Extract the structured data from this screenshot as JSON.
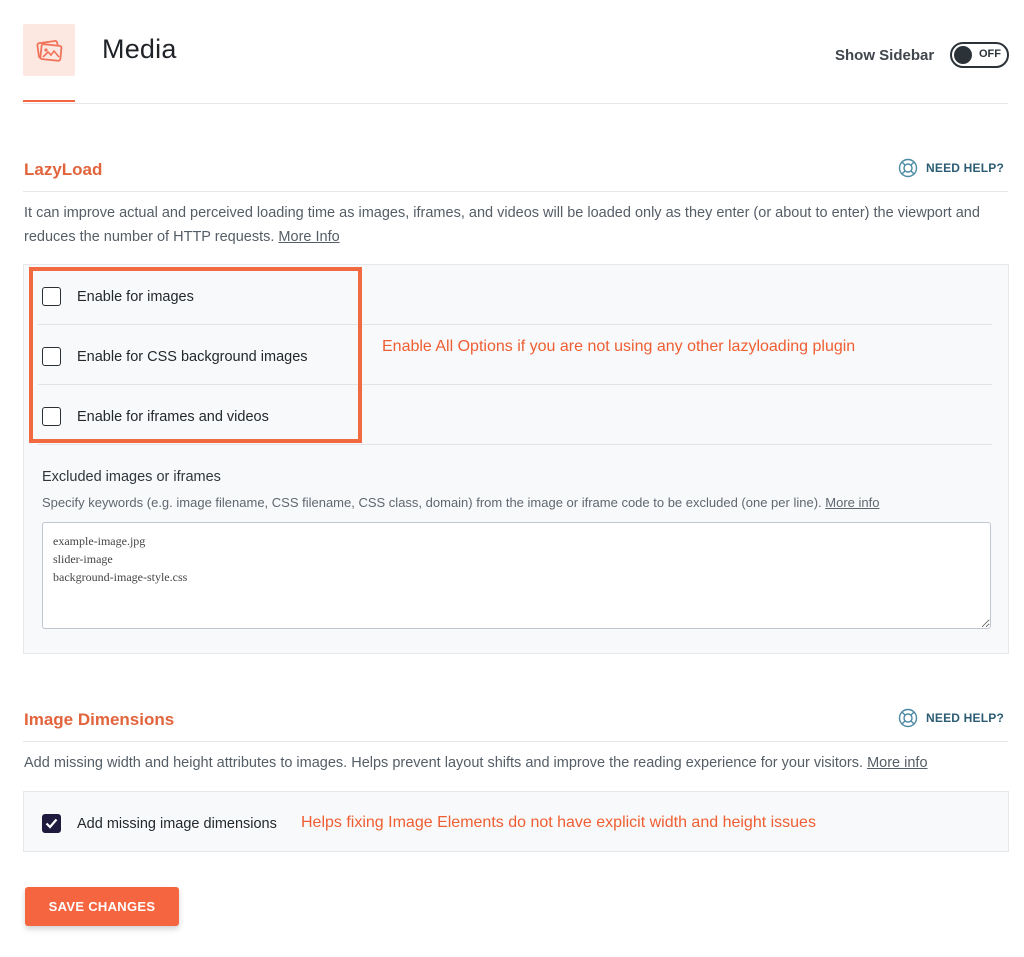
{
  "header": {
    "title": "Media",
    "icon": "image-icon",
    "sidebar_label": "Show Sidebar",
    "sidebar_toggle_state": "OFF"
  },
  "lazyload": {
    "title": "LazyLoad",
    "help_label": "NEED HELP?",
    "description": "It can improve actual and perceived loading time as images, iframes, and videos will be loaded only as they enter (or about to enter) the viewport and reduces the number of HTTP requests.",
    "more_info": "More Info",
    "options": [
      {
        "label": "Enable for images",
        "checked": false
      },
      {
        "label": "Enable for CSS background images",
        "checked": false
      },
      {
        "label": "Enable for iframes and videos",
        "checked": false
      }
    ],
    "annotation": "Enable All Options if you are not using any other lazyloading plugin",
    "excluded": {
      "label": "Excluded images or iframes",
      "help": "Specify keywords (e.g. image filename, CSS filename, CSS class, domain) from the image or iframe code to be excluded (one per line).",
      "more_info": "More info",
      "value": "example-image.jpg\nslider-image\nbackground-image-style.css"
    }
  },
  "dimensions": {
    "title": "Image Dimensions",
    "help_label": "NEED HELP?",
    "description": "Add missing width and height attributes to images. Helps prevent layout shifts and improve the reading experience for your visitors.",
    "more_info": "More info",
    "option": {
      "label": "Add missing image dimensions",
      "checked": true
    },
    "annotation": "Helps fixing Image Elements do not have explicit width and height issues"
  },
  "actions": {
    "save_label": "SAVE CHANGES"
  },
  "colors": {
    "accent": "#f56640",
    "section_title": "#e2643d",
    "help_link": "#2c5d74",
    "checkbox_checked": "#1f1b3f"
  }
}
